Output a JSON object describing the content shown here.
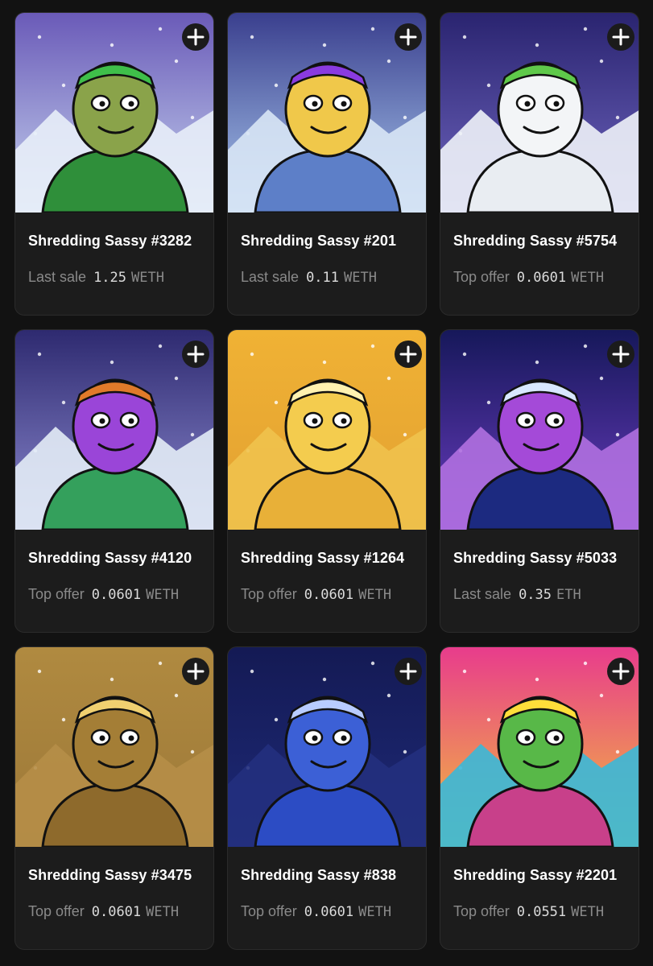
{
  "items": [
    {
      "name": "Shredding Sassy #3282",
      "price_label": "Last sale",
      "price_value": "1.25",
      "currency": "WETH",
      "theme": {
        "sky_top": "#6a5ab8",
        "sky_bottom": "#c6d4ef",
        "ground": "#e8eef8",
        "body": "#2f8f3a",
        "head": "#8aa34a",
        "accent": "#3fbf4a"
      }
    },
    {
      "name": "Shredding Sassy #201",
      "price_label": "Last sale",
      "price_value": "0.11",
      "currency": "WETH",
      "theme": {
        "sky_top": "#3a3f8e",
        "sky_bottom": "#a9c8ee",
        "ground": "#d8e6f5",
        "body": "#5d7fc8",
        "head": "#f0c84a",
        "accent": "#8a3be0"
      }
    },
    {
      "name": "Shredding Sassy #5754",
      "price_label": "Top offer",
      "price_value": "0.0601",
      "currency": "WETH",
      "theme": {
        "sky_top": "#2a2470",
        "sky_bottom": "#7066c0",
        "ground": "#eef2f8",
        "body": "#e9edf2",
        "head": "#f3f5f7",
        "accent": "#5fc94a"
      }
    },
    {
      "name": "Shredding Sassy #4120",
      "price_label": "Top offer",
      "price_value": "0.0601",
      "currency": "WETH",
      "theme": {
        "sky_top": "#2e2a70",
        "sky_bottom": "#8c8ad0",
        "ground": "#e3ecf6",
        "body": "#34a05c",
        "head": "#9a45d8",
        "accent": "#e07a2a"
      }
    },
    {
      "name": "Shredding Sassy #1264",
      "price_label": "Top offer",
      "price_value": "0.0601",
      "currency": "WETH",
      "theme": {
        "sky_top": "#f0b234",
        "sky_bottom": "#e2a032",
        "ground": "#f0c24c",
        "body": "#e8b038",
        "head": "#f4cc4e",
        "accent": "#fff1b0"
      }
    },
    {
      "name": "Shredding Sassy #5033",
      "price_label": "Last sale",
      "price_value": "0.35",
      "currency": "ETH",
      "theme": {
        "sky_top": "#16185a",
        "sky_bottom": "#6a3cc0",
        "ground": "#b070e0",
        "body": "#1c2a80",
        "head": "#a44ad8",
        "accent": "#d8e8ff"
      }
    },
    {
      "name": "Shredding Sassy #3475",
      "price_label": "Top offer",
      "price_value": "0.0601",
      "currency": "WETH",
      "theme": {
        "sky_top": "#b08a40",
        "sky_bottom": "#9c7838",
        "ground": "#b68e48",
        "body": "#8e6a2c",
        "head": "#a47e36",
        "accent": "#f0d070"
      }
    },
    {
      "name": "Shredding Sassy #838",
      "price_label": "Top offer",
      "price_value": "0.0601",
      "currency": "WETH",
      "theme": {
        "sky_top": "#141a54",
        "sky_bottom": "#1e2a78",
        "ground": "#24307e",
        "body": "#2c4cc4",
        "head": "#3c60d6",
        "accent": "#b8ccff"
      }
    },
    {
      "name": "Shredding Sassy #2201",
      "price_label": "Top offer",
      "price_value": "0.0551",
      "currency": "WETH",
      "theme": {
        "sky_top": "#e83c8c",
        "sky_bottom": "#f2c23a",
        "ground": "#3ab8d8",
        "body": "#c8408a",
        "head": "#58b848",
        "accent": "#ffde3a"
      }
    }
  ],
  "add_icon": "plus-icon"
}
